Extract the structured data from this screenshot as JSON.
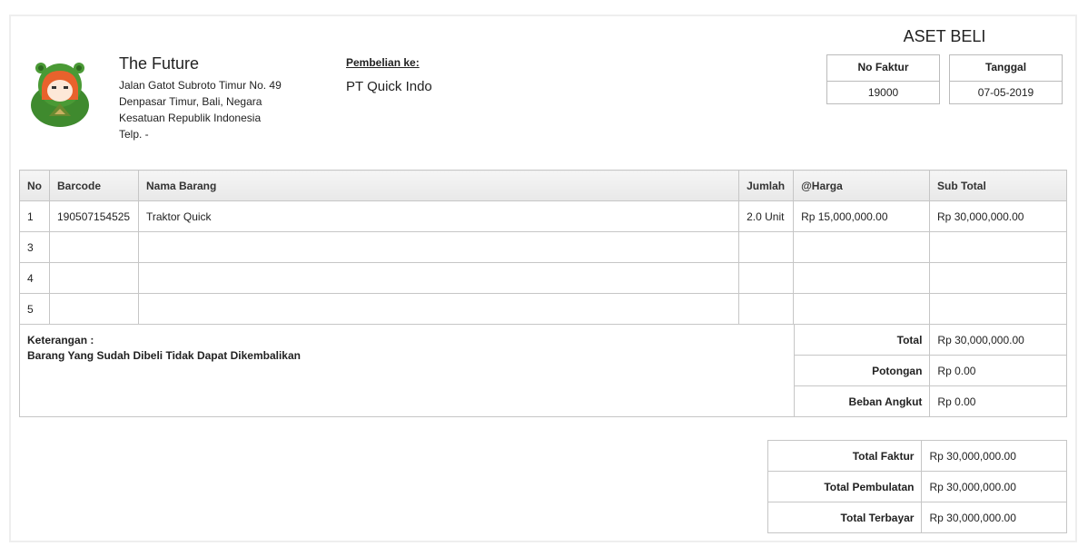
{
  "company": {
    "name": "The Future",
    "address_lines": [
      "Jalan Gatot Subroto Timur No. 49",
      "Denpasar Timur, Bali, Negara",
      "Kesatuan Republik Indonesia",
      "Telp. -"
    ]
  },
  "recipient": {
    "label": "Pembelian ke:",
    "name": "PT Quick Indo"
  },
  "document": {
    "title": "ASET BELI",
    "invoice_no_label": "No Faktur",
    "invoice_no": "19000",
    "date_label": "Tanggal",
    "date": "07-05-2019"
  },
  "items_table": {
    "headers": [
      "No",
      "Barcode",
      "Nama Barang",
      "Jumlah",
      "@Harga",
      "Sub Total"
    ],
    "rows": [
      [
        "1",
        "190507154525",
        "Traktor Quick",
        "2.0 Unit",
        "Rp 15,000,000.00",
        "Rp 30,000,000.00"
      ],
      [
        "3",
        "",
        "",
        "",
        "",
        ""
      ],
      [
        "4",
        "",
        "",
        "",
        "",
        ""
      ],
      [
        "5",
        "",
        "",
        "",
        "",
        ""
      ]
    ]
  },
  "notes": {
    "label": "Keterangan :",
    "text": "Barang Yang Sudah Dibeli Tidak Dapat Dikembalikan"
  },
  "summary": [
    {
      "label": "Total",
      "value": "Rp 30,000,000.00"
    },
    {
      "label": "Potongan",
      "value": "Rp 0.00"
    },
    {
      "label": "Beban Angkut",
      "value": "Rp 0.00"
    }
  ],
  "totals": [
    {
      "label": "Total Faktur",
      "value": "Rp 30,000,000.00"
    },
    {
      "label": "Total Pembulatan",
      "value": "Rp 30,000,000.00"
    },
    {
      "label": "Total Terbayar",
      "value": "Rp 30,000,000.00"
    }
  ],
  "colors": {
    "logo_green": "#3f8a2e",
    "logo_hair": "#e8622c",
    "border": "#c6c6c6",
    "header_bg": "#ececec"
  }
}
